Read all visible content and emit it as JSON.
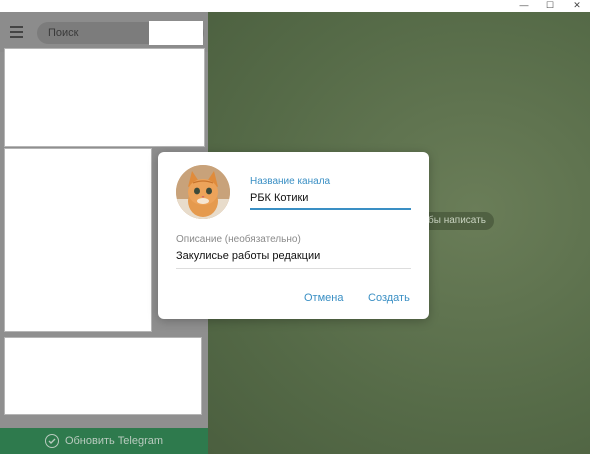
{
  "window": {
    "minimize_glyph": "—",
    "maximize_glyph": "☐",
    "close_glyph": "✕"
  },
  "sidebar": {
    "search": {
      "placeholder": "Поиск",
      "value": ""
    },
    "update_bar": {
      "label": "Обновить Telegram",
      "icon": "telegram-update-icon"
    }
  },
  "chat": {
    "hint_fragment": "бы написать"
  },
  "dialog": {
    "name_label": "Название канала",
    "name_value": "РБК Котики",
    "description_label": "Описание (необязательно)",
    "description_value": "Закулисье работы редакции",
    "cancel_label": "Отмена",
    "create_label": "Создать",
    "avatar_icon": "kitten-photo"
  },
  "colors": {
    "accent": "#3a8fc4",
    "update_bar": "#2e7a4d",
    "chat_background": "#566b48"
  }
}
